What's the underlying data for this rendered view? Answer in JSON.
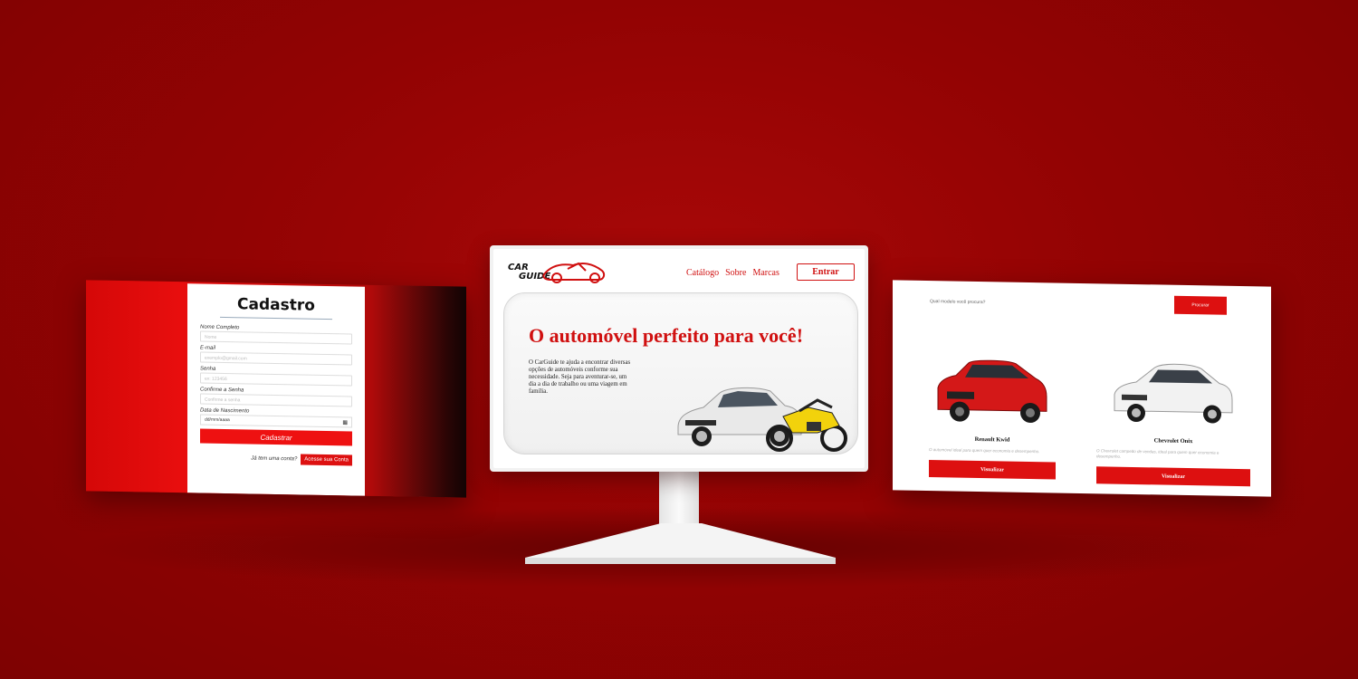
{
  "register_page": {
    "title": "Cadastro",
    "fields": [
      {
        "label": "Nome Completo",
        "placeholder": "Nome"
      },
      {
        "label": "E-mail",
        "placeholder": "exemplo@gmail.com"
      },
      {
        "label": "Senha",
        "placeholder": "ex: 123456"
      },
      {
        "label": "Confirme a Senha",
        "placeholder": "Confirme a senha"
      }
    ],
    "birth_label": "Data de Nascimento",
    "birth_value": "dd/mm/aaaa",
    "submit_label": "Cadastrar",
    "have_account_text": "Já tem uma conta?",
    "login_label": "Acesse sua Conta"
  },
  "home_page": {
    "logo_top": "CAR",
    "logo_bottom": "GUIDE",
    "nav": [
      "Catálogo",
      "Sobre",
      "Marcas"
    ],
    "enter_label": "Entrar",
    "hero_title": "O automóvel perfeito para você!",
    "hero_text": "O CarGuide te ajuda a encontrar diversas opções de automóveis conforme sua necessidade. Seja para aventurar-se, um dia a dia de trabalho ou uma viagem em família."
  },
  "catalog_page": {
    "search_question": "Qual modelo você procura?",
    "search_label": "Procurar",
    "cars": [
      {
        "name": "Renault Kwid",
        "description": "O automóvel ideal para quem quer economia e desempenho.",
        "button": "Visualizar"
      },
      {
        "name": "Chevrolet Onix",
        "description": "O Chevrolet campeão de vendas, ideal para quem quer economia e desempenho.",
        "button": "Visualizar"
      }
    ]
  },
  "colors": {
    "background": "#930303",
    "brand_red": "#d01010",
    "button_red": "#dd1010"
  },
  "icons": [
    "calendar-icon",
    "car-logo-icon",
    "car-image",
    "motorcycle-image"
  ]
}
